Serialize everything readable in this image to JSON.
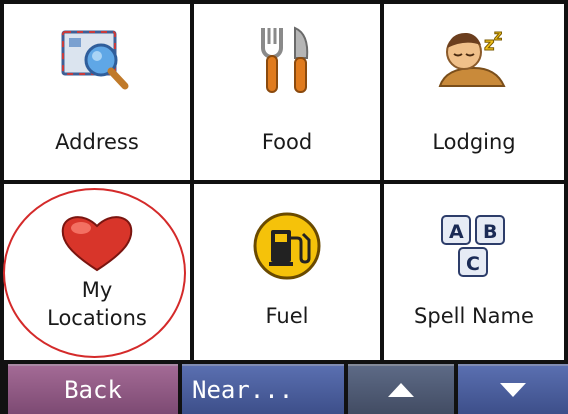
{
  "menu": {
    "items": [
      {
        "label": "Address",
        "icon": "envelope-magnifier-icon"
      },
      {
        "label": "Food",
        "icon": "fork-knife-icon"
      },
      {
        "label": "Lodging",
        "icon": "sleeping-person-icon"
      },
      {
        "label": "My\nLocations",
        "icon": "heart-icon"
      },
      {
        "label": "Fuel",
        "icon": "fuel-pump-icon"
      },
      {
        "label": "Spell Name",
        "icon": "abc-keys-icon"
      }
    ]
  },
  "toolbar": {
    "back_label": "Back",
    "near_label": "Near...",
    "up_icon": "arrow-up-icon",
    "down_icon": "arrow-down-icon"
  },
  "colors": {
    "highlight_ring": "#d42a2a",
    "back_button": "#8f5a84",
    "near_button": "#4a5c9c",
    "up_button": "#4f5a73"
  }
}
